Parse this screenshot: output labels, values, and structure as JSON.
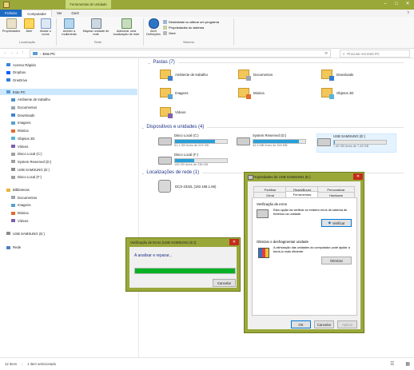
{
  "window": {
    "context_tab": "Ferramentas de Unidade"
  },
  "tabs": [
    "Ficheiro",
    "Computador",
    "Ver",
    "Gerir"
  ],
  "ribbon": {
    "buttons": [
      {
        "label": "Propriedades",
        "icon": "properties-icon"
      },
      {
        "label": "Abrir",
        "icon": "open-icon"
      },
      {
        "label": "Mudar o nome",
        "icon": "rename-icon"
      },
      {
        "label": "Aceder a multimédia",
        "icon": "media-icon"
      },
      {
        "label": "Mapear unidade de rede",
        "icon": "map-drive-icon"
      },
      {
        "label": "Adicionar uma localização de rede",
        "icon": "add-location-icon"
      },
      {
        "label": "Abrir Definições",
        "icon": "settings-icon"
      }
    ],
    "small_commands": [
      "Desinstalar ou alterar um programa",
      "Propriedades do sistema",
      "Gerir"
    ],
    "groups": [
      "Localização",
      "Rede",
      "Sistema"
    ]
  },
  "address": {
    "path": "Este PC",
    "search_placeholder": "Procurar em Este PC"
  },
  "nav": [
    {
      "label": "Acesso Rápido",
      "icon": "star-icon",
      "indent": 0
    },
    {
      "label": "Dropbox",
      "icon": "dropbox-icon",
      "indent": 0
    },
    {
      "label": "OneDrive",
      "icon": "cloud-icon",
      "indent": 0
    },
    {
      "label": "Este PC",
      "icon": "computer-icon",
      "indent": 0,
      "selected": true
    },
    {
      "label": "Ambiente de trabalho",
      "icon": "desktop-icon",
      "indent": 1
    },
    {
      "label": "Documentos",
      "icon": "documents-icon",
      "indent": 1
    },
    {
      "label": "Downloads",
      "icon": "download-icon",
      "indent": 1
    },
    {
      "label": "Imagens",
      "icon": "pictures-icon",
      "indent": 1
    },
    {
      "label": "Música",
      "icon": "music-icon",
      "indent": 1
    },
    {
      "label": "Objetos 3D",
      "icon": "objects-3d-icon",
      "indent": 1
    },
    {
      "label": "Vídeos",
      "icon": "videos-icon",
      "indent": 1
    },
    {
      "label": "Disco Local (C:)",
      "icon": "drive-icon",
      "indent": 1
    },
    {
      "label": "System Reserved (D:)",
      "icon": "drive-icon",
      "indent": 1
    },
    {
      "label": "USB SAMSUNG (E:)",
      "icon": "usb-drive-icon",
      "indent": 1
    },
    {
      "label": "Disco Local (F:)",
      "icon": "drive-icon",
      "indent": 1
    },
    {
      "label": "Bibliotecas",
      "icon": "libraries-icon",
      "indent": 0
    },
    {
      "label": "Documentos",
      "icon": "documents-icon",
      "indent": 1
    },
    {
      "label": "Imagens",
      "icon": "pictures-icon",
      "indent": 1
    },
    {
      "label": "Música",
      "icon": "music-icon",
      "indent": 1
    },
    {
      "label": "Vídeos",
      "icon": "videos-icon",
      "indent": 1
    },
    {
      "label": "USB SAMSUNG (E:)",
      "icon": "usb-drive-icon",
      "indent": 0
    },
    {
      "label": "Rede",
      "icon": "network-icon",
      "indent": 0
    }
  ],
  "sections": {
    "folders": "Pastas (7)",
    "devices": "Dispositivos e unidades (4)",
    "network": "Localizações de rede (1)"
  },
  "folders": [
    {
      "label": "Ambiente de trabalho",
      "icon": "desktop-folder-icon"
    },
    {
      "label": "Documentos",
      "icon": "documents-folder-icon"
    },
    {
      "label": "Downloads",
      "icon": "downloads-folder-icon"
    },
    {
      "label": "Imagens",
      "icon": "pictures-folder-icon"
    },
    {
      "label": "Música",
      "icon": "music-folder-icon"
    },
    {
      "label": "Objetos 3D",
      "icon": "objects-3d-folder-icon"
    },
    {
      "label": "Vídeos",
      "icon": "videos-folder-icon"
    }
  ],
  "drives": [
    {
      "label": "Disco Local (C:)",
      "free": "51,1 GB livres de 223 GB",
      "used_fraction": 0.77
    },
    {
      "label": "System Reserved (D:)",
      "free": "40,3 MB livres de 349 MB",
      "used_fraction": 0.88
    },
    {
      "label": "USB SAMSUNG (E:)",
      "free": "7,40 GB livres de 7,45 GB",
      "used_fraction": 0.01
    },
    {
      "label": "Disco Local (F:)",
      "free": "149 GB livres de 236 GB",
      "used_fraction": 0.37
    }
  ],
  "network_locations": [
    {
      "label": "DCS-2332L (192.168.1.66)"
    }
  ],
  "status": {
    "items": "12 itens",
    "selected": "1 item selecionado"
  },
  "check_dialog": {
    "title": "Verificação de Erros (USB SAMSUNG (E:))",
    "message": "A analisar e reparar...",
    "progress": 1.0,
    "cancel": "Cancelar"
  },
  "props_dialog": {
    "title": "Propriedades de USB SAMSUNG (E:)",
    "tabs_row1": [
      "Partilhar",
      "ReadyBoost",
      "Personalizar"
    ],
    "tabs_row2": [
      "Geral",
      "Ferramentas",
      "Hardware"
    ],
    "check_section": "Verificação de erros",
    "check_text": "Esta opção irá verificar se existem erros de sistema de ficheiros na unidade.",
    "check_button": "Verificar",
    "defrag_section": "Otimizar e desfragmentar unidade",
    "defrag_text": "A otimização das unidades do computador pode ajudar a torná-lo mais eficiente.",
    "optimize_button": "Otimizar",
    "ok": "OK",
    "cancel": "Cancelar",
    "apply": "Aplicar"
  }
}
